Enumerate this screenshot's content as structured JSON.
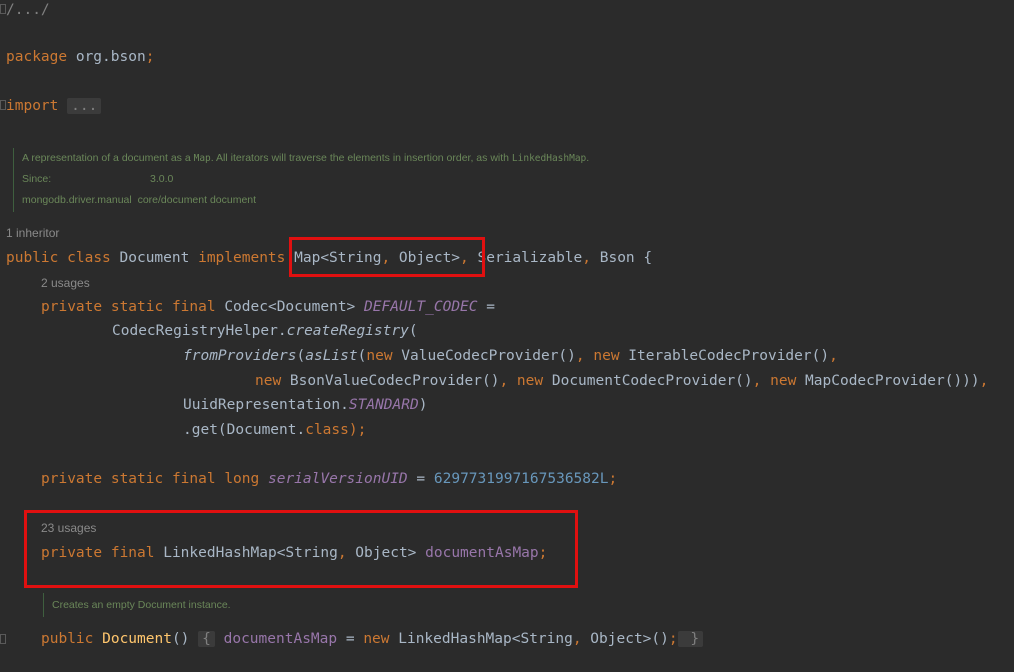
{
  "editor": {
    "folded_header": "/.../",
    "package_line": {
      "keyword": "package",
      "name": "org.bson",
      "semicolon": ";"
    },
    "import_line": {
      "keyword": "import",
      "folded": "..."
    },
    "class_doc": {
      "text_before": "A representation of a document as a ",
      "code_map": "Map",
      "text_middle": ". All iterators will traverse the elements in insertion order, as with ",
      "code_linked": "LinkedHashMap",
      "text_after": ".",
      "since_label": "Since:",
      "since_value": "3.0.0",
      "manual_label": "mongodb.driver.manual",
      "manual_value": "core/document document"
    },
    "inheritor_hint": "1 inheritor",
    "class_decl": {
      "mod1": "public",
      "mod2": "class",
      "name": "Document",
      "implements": "implements",
      "iface1": "Map<String",
      "comma1": ",",
      "iface1b": " Object>",
      "comma2": ",",
      "iface2": " Serializable",
      "comma3": ",",
      "iface3": " Bson {"
    },
    "codec_usages": "2 usages",
    "codec_line": {
      "mods": "private static final ",
      "type": "Codec<Document> ",
      "field": "DEFAULT_CODEC",
      "eq": " ="
    },
    "registry_line": {
      "cls": "CodecRegistryHelper.",
      "method": "createRegistry",
      "paren": "("
    },
    "providers_line": {
      "m1": "fromProviders",
      "p1": "(",
      "m2": "asList",
      "p2": "(",
      "n1": "new",
      "c1": " ValueCodecProvider()",
      "s1": ", ",
      "n2": "new",
      "c2": " IterableCodecProvider()",
      "s2": ","
    },
    "providers_line2": {
      "n1": "new",
      "c1": " BsonValueCodecProvider()",
      "s1": ", ",
      "n2": "new",
      "c2": " DocumentCodecProvider()",
      "s2": ", ",
      "n3": "new",
      "c3": " MapCodecProvider()))",
      "s3": ","
    },
    "uuid_line": {
      "cls": "UuidRepresentation.",
      "field": "STANDARD",
      "close": ")"
    },
    "get_line": {
      "pre": ".get(Document.",
      "kw": "class",
      "post": ");"
    },
    "serial_line": {
      "mods": "private static final long ",
      "field": "serialVersionUID",
      "eq": " = ",
      "num": "6297731997167536582L",
      "semi": ";"
    },
    "map_usages": "23 usages",
    "map_line": {
      "mods": "private final ",
      "type": "LinkedHashMap<String",
      "comma": ",",
      "type2": " Object> ",
      "field": "documentAsMap",
      "semi": ";"
    },
    "ctor_doc": "Creates an empty Document instance.",
    "ctor_line": {
      "mod": "public ",
      "name": "Document",
      "parens": "() ",
      "lb": "{",
      "field": " documentAsMap",
      "eq": " = ",
      "new": "new",
      "type": " LinkedHashMap<String",
      "comma": ",",
      "type2": " Object>()",
      "semi": ";",
      "rb": " }"
    }
  },
  "colors": {
    "background": "#2b2b2b",
    "keyword": "#cc7832",
    "field": "#9876aa",
    "number": "#6897bb",
    "doc": "#6a8759",
    "highlight": "#e01010"
  }
}
